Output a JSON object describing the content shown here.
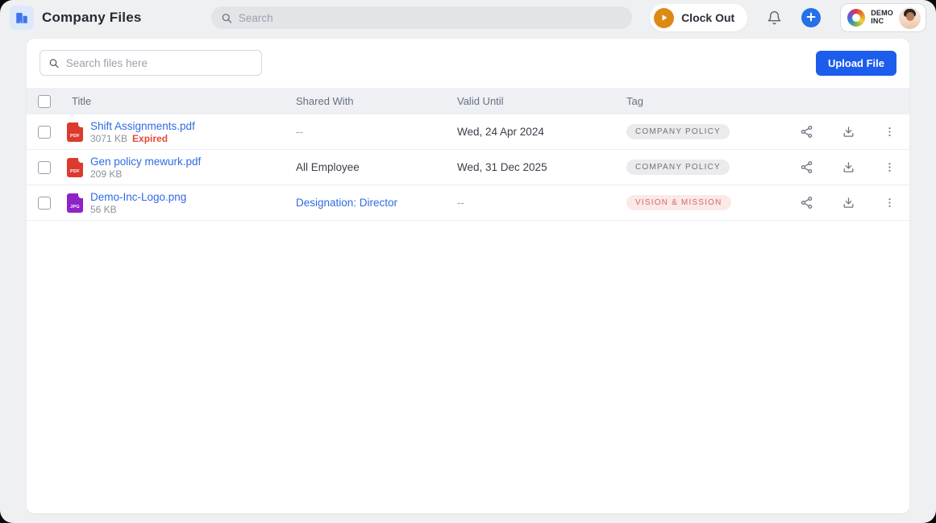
{
  "header": {
    "title": "Company Files",
    "search_placeholder": "Search",
    "clock_out_label": "Clock Out",
    "company_name_line1": "DEMO",
    "company_name_line2": "INC"
  },
  "toolbar": {
    "search_placeholder": "Search files here",
    "upload_label": "Upload File"
  },
  "table": {
    "headers": {
      "title": "Title",
      "shared_with": "Shared With",
      "valid_until": "Valid Until",
      "tag": "Tag"
    },
    "rows": [
      {
        "title": "Shift Assignments.pdf",
        "size": "3071 KB",
        "status": "Expired",
        "file_type": "PDF",
        "shared_with": "--",
        "valid_until": "Wed, 24 Apr 2024",
        "tag": "COMPANY POLICY"
      },
      {
        "title": "Gen policy mewurk.pdf",
        "size": "209 KB",
        "file_type": "PDF",
        "shared_with": "All Employee",
        "valid_until": "Wed, 31 Dec 2025",
        "tag": "COMPANY POLICY"
      },
      {
        "title": "Demo-Inc-Logo.png",
        "size": "56 KB",
        "file_type": "JPG",
        "shared_with": "Designation: Director",
        "valid_until": "--",
        "tag": "VISION & MISSION"
      }
    ]
  },
  "icons": {
    "app": "building-icon",
    "search": "search-icon",
    "clock": "play-icon",
    "notifications": "bell-icon",
    "add": "plus-icon",
    "row_actions": [
      "share-icon",
      "download-icon",
      "kebab-menu-icon"
    ]
  },
  "colors": {
    "accent_blue": "#1d5ded",
    "link_blue": "#2e6be4",
    "clock_orange": "#dd8a15",
    "pdf_red": "#dd3a2e",
    "image_purple": "#9023c8",
    "expired_red": "#e8493c",
    "tag_gray_bg": "#ebebed",
    "tag_gray_text": "#6f7378",
    "tag_red_bg": "#fbe9e8",
    "tag_red_text": "#d06b63"
  }
}
